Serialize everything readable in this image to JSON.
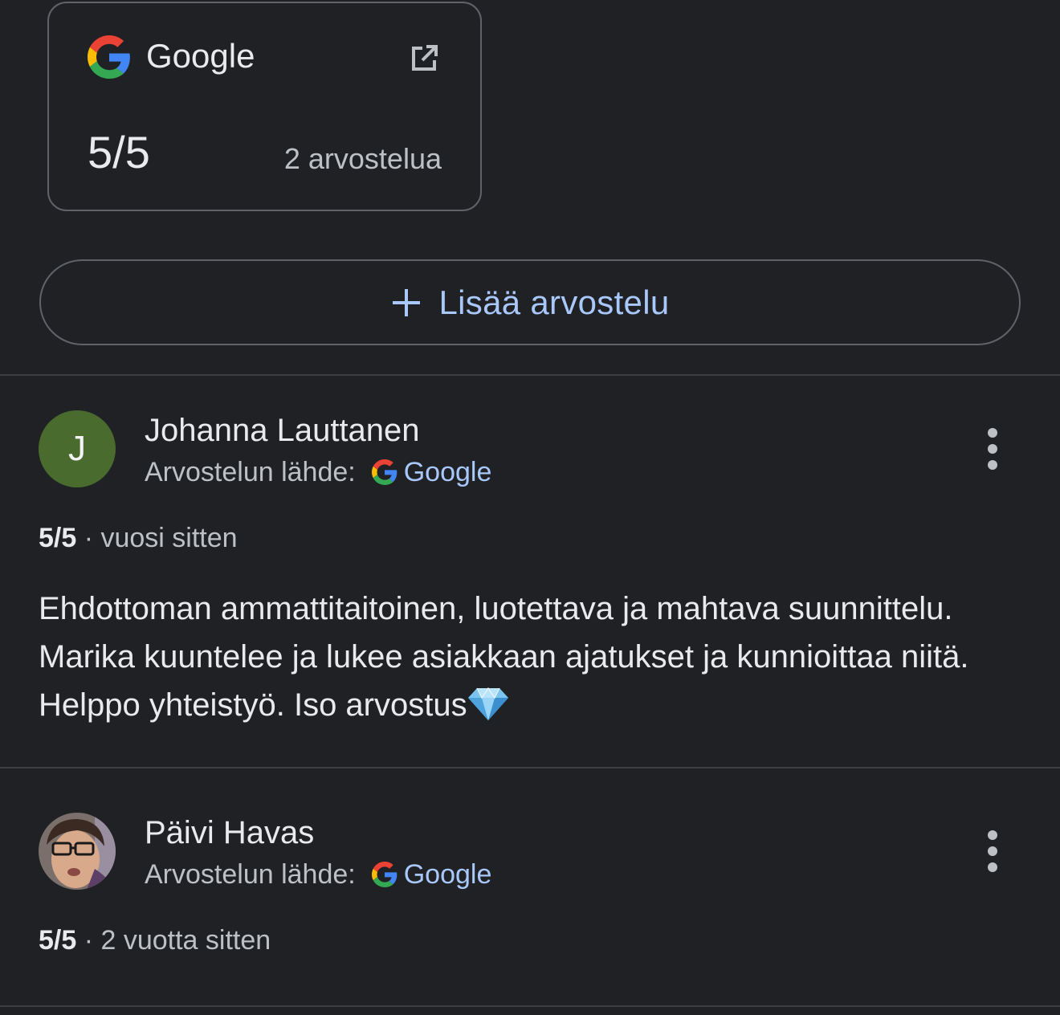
{
  "source_card": {
    "name": "Google",
    "rating": "5/5",
    "count": "2 arvostelua",
    "icon": "external-link-icon"
  },
  "add_review": {
    "label": "Lisää arvostelu",
    "icon": "plus-icon"
  },
  "reviews": [
    {
      "name": "Johanna Lauttanen",
      "avatar_letter": "J",
      "avatar_color": "#4a6b2e",
      "source_label": "Arvostelun lähde:",
      "source_name": "Google",
      "rating": "5/5",
      "separator": " · ",
      "time": "vuosi sitten",
      "text": "Ehdottoman ammattitaitoinen, luotettava ja mahtava suunnittelu. Marika kuuntelee ja lukee asiakkaan ajatukset ja kunnioittaa niitä. Helppo yhteistyö. Iso arvostus",
      "emoji": "gem-icon"
    },
    {
      "name": "Päivi Havas",
      "avatar": "photo",
      "source_label": "Arvostelun lähde:",
      "source_name": "Google",
      "rating": "5/5",
      "separator": " · ",
      "time": "2 vuotta sitten"
    }
  ],
  "colors": {
    "background": "#202124",
    "text": "#e8eaed",
    "secondary_text": "#bdc1c6",
    "link": "#a8c7fa",
    "border": "#5f6368"
  }
}
